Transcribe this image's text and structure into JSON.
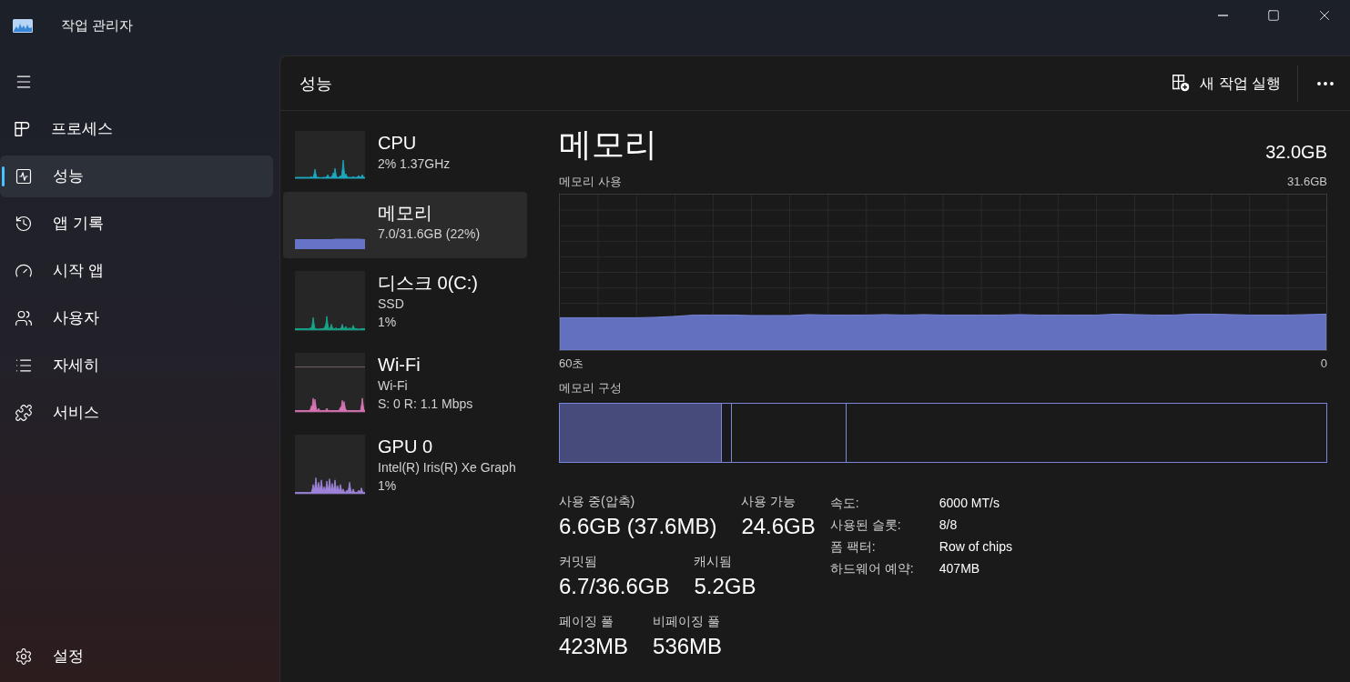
{
  "window": {
    "title": "작업 관리자"
  },
  "sidebar": {
    "items": [
      {
        "label": "프로세스",
        "selected": false
      },
      {
        "label": "성능",
        "selected": true
      },
      {
        "label": "앱 기록",
        "selected": false
      },
      {
        "label": "시작 앱",
        "selected": false
      },
      {
        "label": "사용자",
        "selected": false
      },
      {
        "label": "자세히",
        "selected": false
      },
      {
        "label": "서비스",
        "selected": false
      }
    ],
    "footer": {
      "label": "설정"
    }
  },
  "header": {
    "title": "성능",
    "run_task": "새 작업 실행"
  },
  "perf_list": [
    {
      "name": "CPU",
      "lines": [
        "2% 1.37GHz"
      ],
      "kind": "sparkline",
      "color": "#1ba9c2",
      "selected": false
    },
    {
      "name": "메모리",
      "lines": [
        "7.0/31.6GB (22%)"
      ],
      "kind": "bar",
      "color": "#6673c6",
      "selected": true
    },
    {
      "name": "디스크 0(C:)",
      "lines": [
        "SSD",
        "1%"
      ],
      "kind": "sparkline",
      "color": "#17a58b",
      "selected": false
    },
    {
      "name": "Wi-Fi",
      "lines": [
        "Wi-Fi",
        "S: 0 R: 1.1 Mbps"
      ],
      "kind": "sparkline",
      "color": "#d673b3",
      "selected": false
    },
    {
      "name": "GPU 0",
      "lines": [
        "Intel(R) Iris(R) Xe Graph",
        "1%"
      ],
      "kind": "sparkline",
      "color": "#9d82d8",
      "selected": false
    }
  ],
  "detail": {
    "title": "메모리",
    "total": "32.0GB",
    "usage_label": "메모리 사용",
    "usage_max": "31.6GB",
    "time_start": "60초",
    "time_end": "0",
    "composition_label": "메모리 구성",
    "composition": {
      "level": 0.211,
      "dividers": [
        {
          "level": 0.224
        },
        {
          "level": 0.374
        }
      ]
    },
    "stats": [
      [
        {
          "label": "사용 중(압축)",
          "value": "6.6GB (37.6MB)"
        },
        {
          "label": "사용 가능",
          "value": "24.6GB"
        }
      ],
      [
        {
          "label": "커밋됨",
          "value": "6.7/36.6GB"
        },
        {
          "label": "캐시됨",
          "value": "5.2GB"
        }
      ],
      [
        {
          "label": "페이징 풀",
          "value": "423MB"
        },
        {
          "label": "비페이징 풀",
          "value": "536MB"
        }
      ]
    ],
    "specs": [
      {
        "label": "속도:",
        "value": "6000 MT/s"
      },
      {
        "label": "사용된 슬롯:",
        "value": "8/8"
      },
      {
        "label": "폼 팩터:",
        "value": "Row of chips"
      },
      {
        "label": "하드웨어 예약:",
        "value": "407MB"
      }
    ]
  }
}
